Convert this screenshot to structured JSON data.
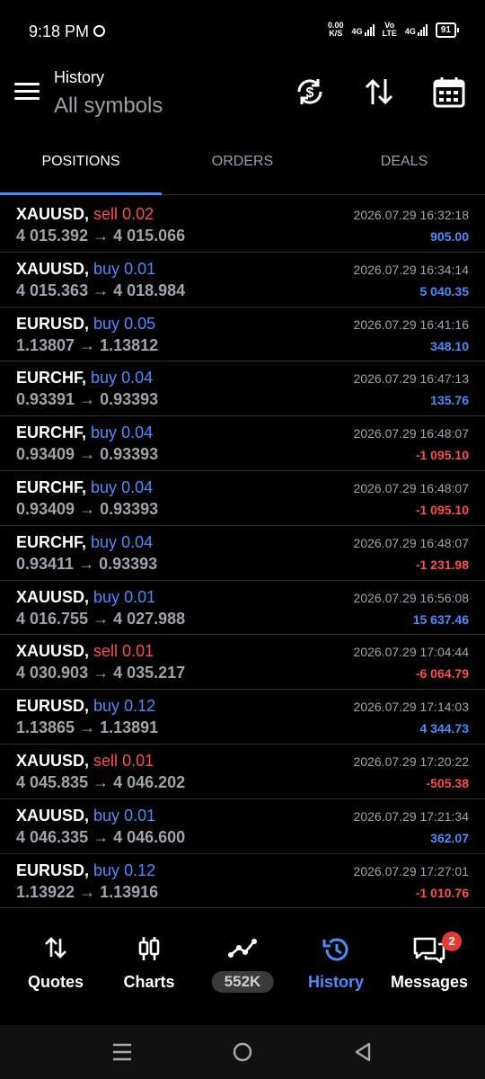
{
  "status": {
    "time": "9:18 PM",
    "speed_top": "0.00",
    "speed_unit": "K/S",
    "net1": "4G",
    "volte_top": "Vo",
    "volte_bottom": "LTE",
    "net2": "4G",
    "battery": "91"
  },
  "header": {
    "label": "History",
    "title": "All symbols",
    "icons": [
      "sync-currency-icon",
      "sort-icon",
      "calendar-icon"
    ]
  },
  "tabs": [
    {
      "label": "POSITIONS",
      "active": true
    },
    {
      "label": "ORDERS",
      "active": false
    },
    {
      "label": "DEALS",
      "active": false
    }
  ],
  "positions": [
    {
      "symbol": "XAUUSD,",
      "side": "sell",
      "volume": "0.02",
      "open": "4 015.392",
      "close": "4 015.066",
      "time": "2026.07.29 16:32:18",
      "profit": "905.00"
    },
    {
      "symbol": "XAUUSD,",
      "side": "buy",
      "volume": "0.01",
      "open": "4 015.363",
      "close": "4 018.984",
      "time": "2026.07.29 16:34:14",
      "profit": "5 040.35"
    },
    {
      "symbol": "EURUSD,",
      "side": "buy",
      "volume": "0.05",
      "open": "1.13807",
      "close": "1.13812",
      "time": "2026.07.29 16:41:16",
      "profit": "348.10"
    },
    {
      "symbol": "EURCHF,",
      "side": "buy",
      "volume": "0.04",
      "open": "0.93391",
      "close": "0.93393",
      "time": "2026.07.29 16:47:13",
      "profit": "135.76"
    },
    {
      "symbol": "EURCHF,",
      "side": "buy",
      "volume": "0.04",
      "open": "0.93409",
      "close": "0.93393",
      "time": "2026.07.29 16:48:07",
      "profit": "-1 095.10"
    },
    {
      "symbol": "EURCHF,",
      "side": "buy",
      "volume": "0.04",
      "open": "0.93409",
      "close": "0.93393",
      "time": "2026.07.29 16:48:07",
      "profit": "-1 095.10"
    },
    {
      "symbol": "EURCHF,",
      "side": "buy",
      "volume": "0.04",
      "open": "0.93411",
      "close": "0.93393",
      "time": "2026.07.29 16:48:07",
      "profit": "-1 231.98"
    },
    {
      "symbol": "XAUUSD,",
      "side": "buy",
      "volume": "0.01",
      "open": "4 016.755",
      "close": "4 027.988",
      "time": "2026.07.29 16:56:08",
      "profit": "15 637.46"
    },
    {
      "symbol": "XAUUSD,",
      "side": "sell",
      "volume": "0.01",
      "open": "4 030.903",
      "close": "4 035.217",
      "time": "2026.07.29 17:04:44",
      "profit": "-6 064.79"
    },
    {
      "symbol": "EURUSD,",
      "side": "buy",
      "volume": "0.12",
      "open": "1.13865",
      "close": "1.13891",
      "time": "2026.07.29 17:14:03",
      "profit": "4 344.73"
    },
    {
      "symbol": "XAUUSD,",
      "side": "sell",
      "volume": "0.01",
      "open": "4 045.835",
      "close": "4 046.202",
      "time": "2026.07.29 17:20:22",
      "profit": "-505.38"
    },
    {
      "symbol": "XAUUSD,",
      "side": "buy",
      "volume": "0.01",
      "open": "4 046.335",
      "close": "4 046.600",
      "time": "2026.07.29 17:21:34",
      "profit": "362.07"
    },
    {
      "symbol": "EURUSD,",
      "side": "buy",
      "volume": "0.12",
      "open": "1.13922",
      "close": "1.13916",
      "time": "2026.07.29 17:27:01",
      "profit": "-1 010.76"
    }
  ],
  "arrow": "→",
  "bottom_nav": [
    {
      "label": "Quotes",
      "icon": "quotes-icon"
    },
    {
      "label": "Charts",
      "icon": "charts-icon"
    },
    {
      "label": "552K",
      "icon": "trade-icon"
    },
    {
      "label": "History",
      "icon": "history-icon",
      "active": true
    },
    {
      "label": "Messages",
      "icon": "messages-icon",
      "badge": "2"
    }
  ],
  "colors": {
    "buy": "#4a8dff",
    "sell": "#ff4d4d",
    "accent": "#3f8cff"
  }
}
